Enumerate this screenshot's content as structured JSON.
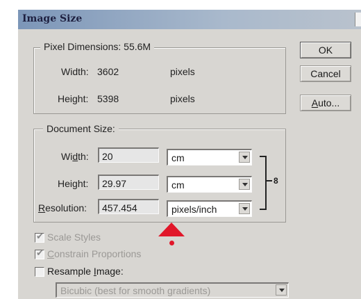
{
  "window": {
    "title": "Image Size"
  },
  "pixel_dimensions": {
    "legend": "Pixel Dimensions:",
    "size": "55.6M",
    "width_label": "Width:",
    "width_value": "3602",
    "width_unit": "pixels",
    "height_label": "Height:",
    "height_value": "5398",
    "height_unit": "pixels"
  },
  "document_size": {
    "legend": "Document Size:",
    "width_label_a": "Wi",
    "width_label_u": "d",
    "width_label_b": "th:",
    "width_value": "20",
    "width_unit": "cm",
    "height_label_a": "Hei",
    "height_label_u": "g",
    "height_label_b": "ht:",
    "height_value": "29.97",
    "height_unit": "cm",
    "resolution_label_u": "R",
    "resolution_label_b": "esolution:",
    "resolution_value": "457.454",
    "resolution_unit": "pixels/inch",
    "link_icon": "chain-link-icon"
  },
  "buttons": {
    "ok": "OK",
    "cancel": "Cancel",
    "auto_u": "A",
    "auto_b": "uto..."
  },
  "options": {
    "scale_styles": "Scale Styles",
    "constrain_u": "C",
    "constrain_b": "onstrain Proportions",
    "resample_a": "Resample ",
    "resample_u": "I",
    "resample_b": "mage:",
    "scale_styles_checked": true,
    "constrain_checked": true,
    "resample_checked": false,
    "resample_method": "Bicubic (best for smooth gradients)"
  },
  "colors": {
    "annotation_red": "#e1172a",
    "title_bar": "#7c96b8"
  }
}
